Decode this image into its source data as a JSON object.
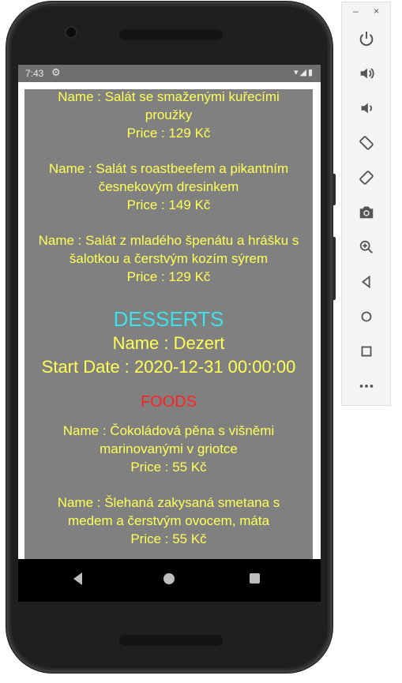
{
  "status_bar": {
    "time": "7:43"
  },
  "menu": {
    "salads": [
      {
        "name": "Name : Salát se smaženými kuřecími proužky",
        "price": "Price : 129 Kč"
      },
      {
        "name": "Name : Salát s roastbeefem a pikantním česnekovým dresinkem",
        "price": "Price : 149 Kč"
      },
      {
        "name": "Name : Salát z mladého špenátu a hrášku s šalotkou a čerstvým kozím sýrem",
        "price": "Price : 129 Kč"
      }
    ],
    "desserts_section": {
      "title": "DESSERTS",
      "category_name": "Name : Dezert",
      "start_date": "Start Date : 2020-12-31 00:00:00",
      "foods_label": "FOODS",
      "items": [
        {
          "name": "Name : Čokoládová pěna s višněmi marinovanými v griotce",
          "price": "Price : 55 Kč"
        },
        {
          "name": "Name : Šlehaná zakysaná smetana s medem a čerstvým ovocem, máta",
          "price": "Price : 55 Kč"
        }
      ]
    }
  },
  "colors": {
    "item_text": "#ffff55",
    "section_title": "#40e0e8",
    "foods_label": "#ff2020",
    "content_bg": "#808080"
  },
  "emulator_toolbar": {
    "minimize": "–",
    "close": "×",
    "buttons": [
      "power-icon",
      "volume-up-icon",
      "volume-down-icon",
      "rotate-left-icon",
      "rotate-right-icon",
      "camera-icon",
      "zoom-icon",
      "back-icon",
      "home-icon",
      "overview-icon",
      "more-icon"
    ]
  }
}
